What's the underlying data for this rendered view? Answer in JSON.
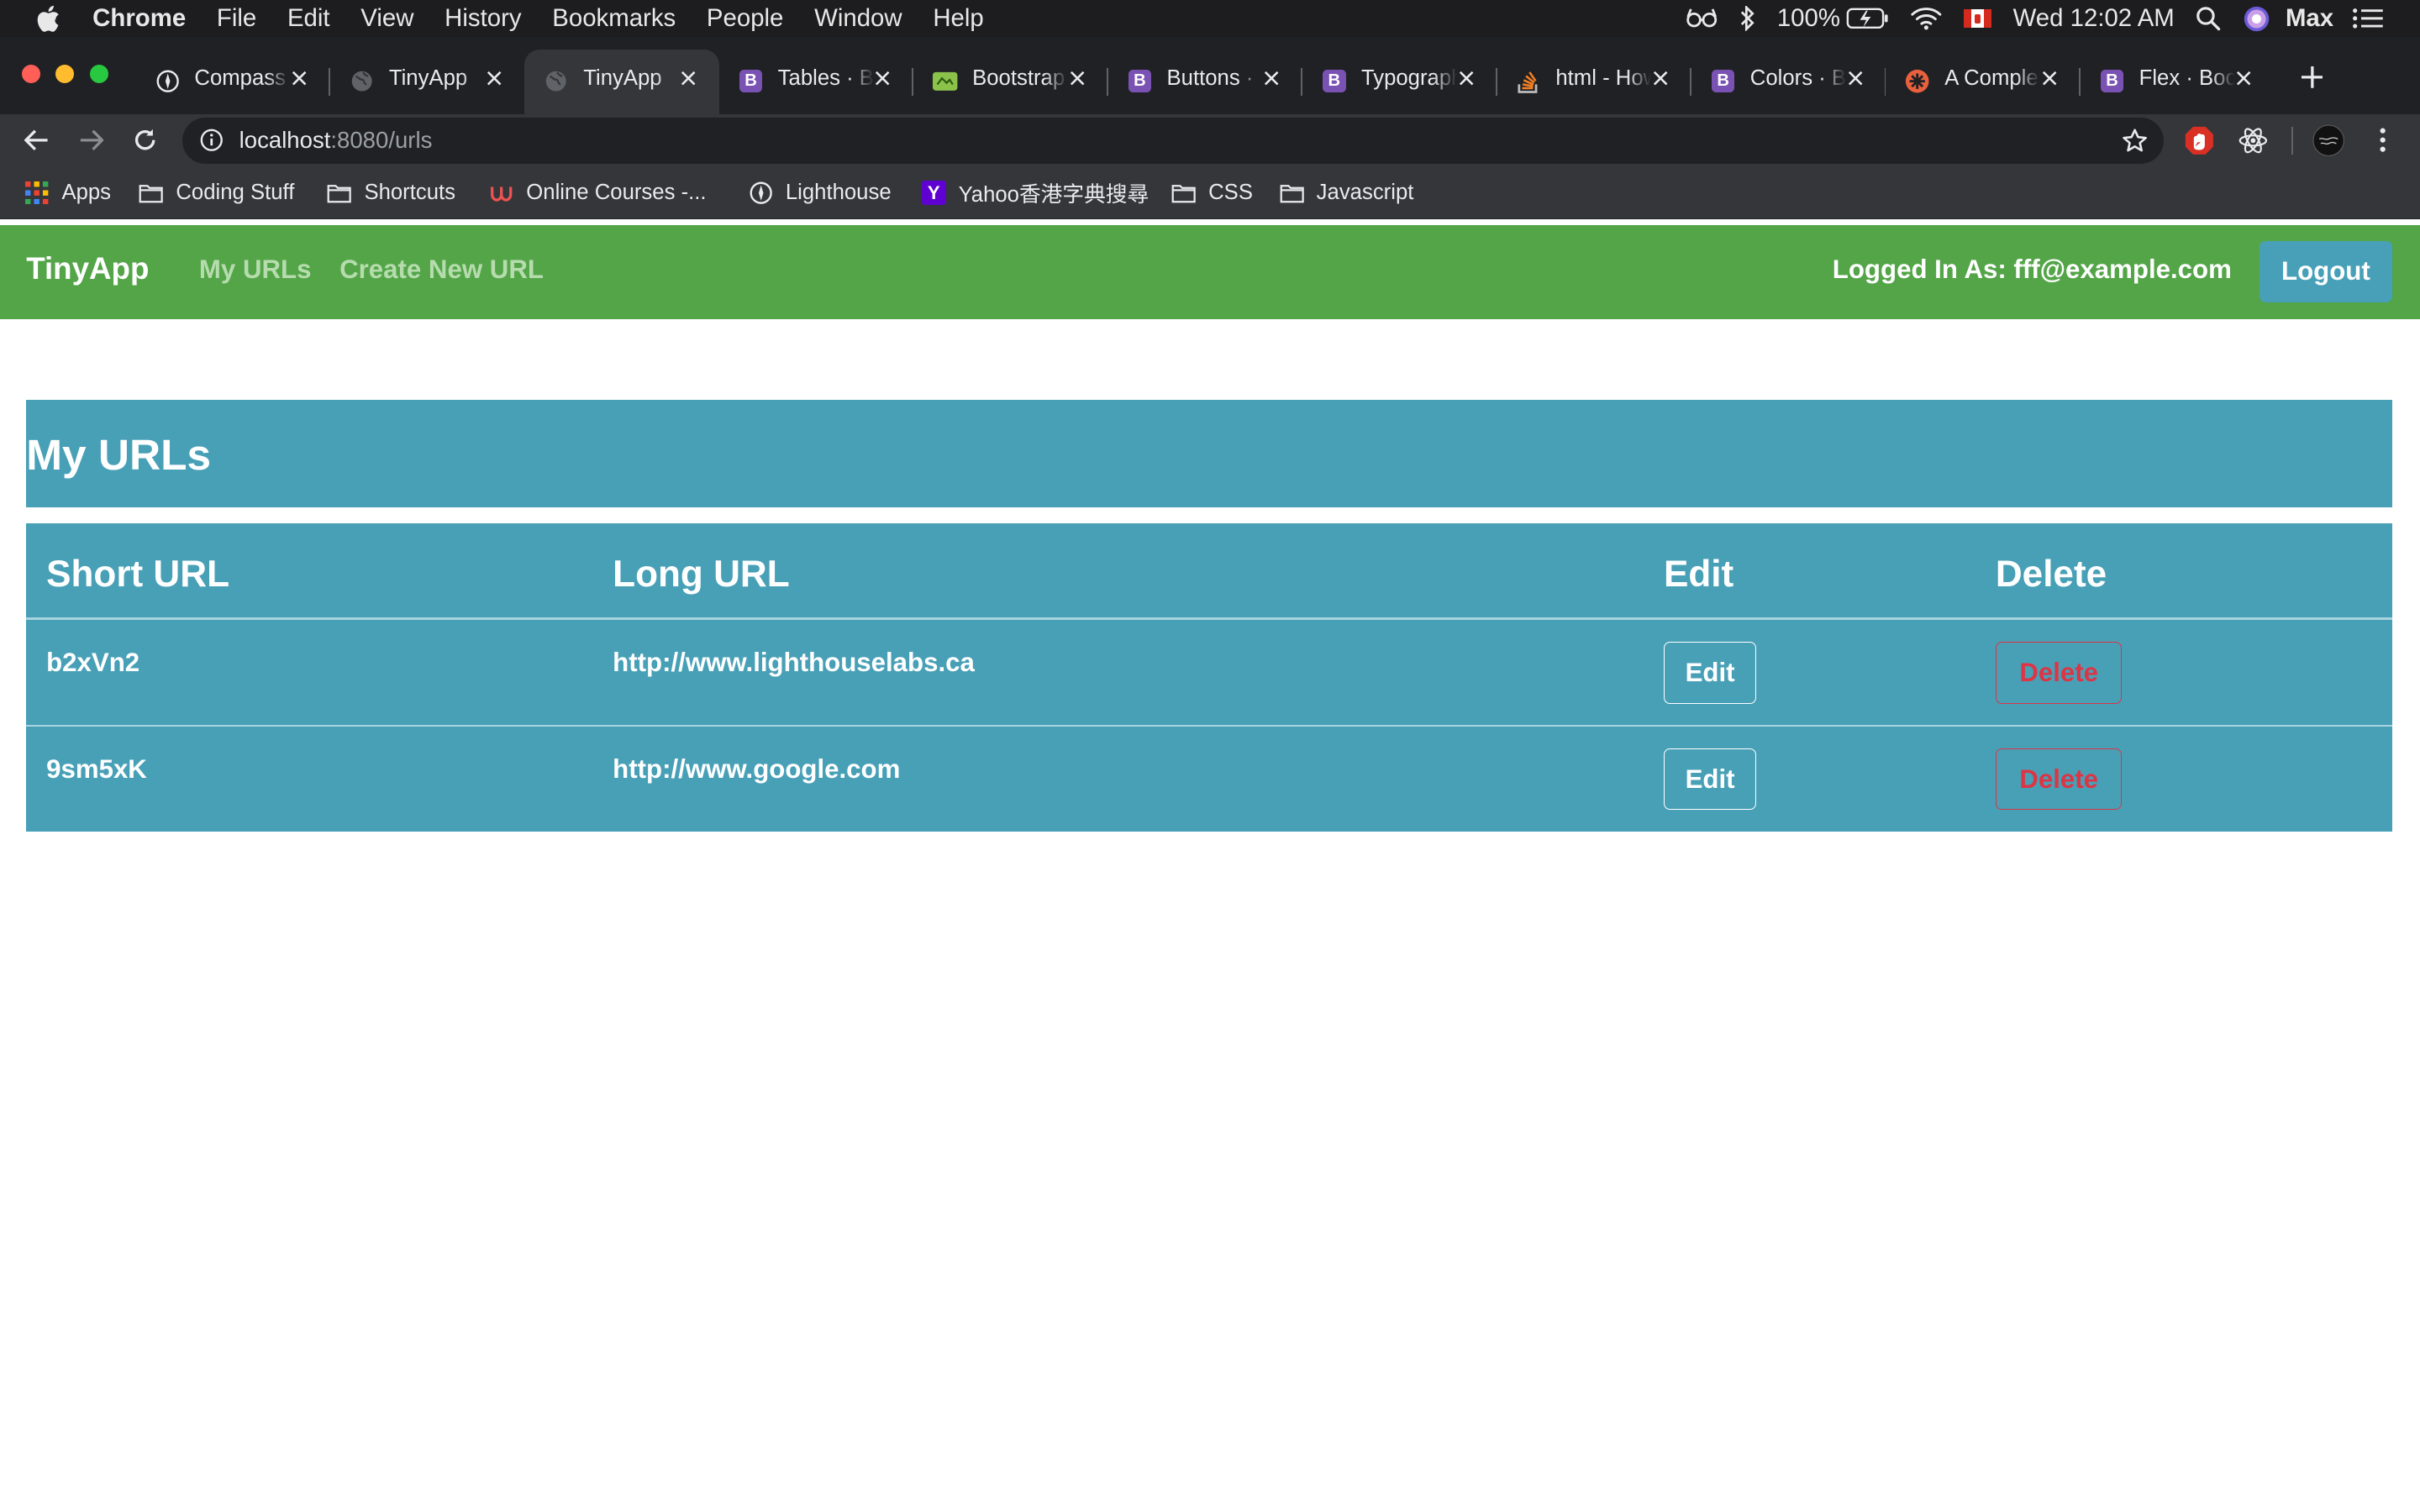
{
  "menubar": {
    "app_name": "Chrome",
    "items": [
      "File",
      "Edit",
      "View",
      "History",
      "Bookmarks",
      "People",
      "Window",
      "Help"
    ],
    "battery": "100%",
    "clock": "Wed 12:02 AM",
    "user": "Max"
  },
  "tabs": [
    {
      "title": "Compass",
      "icon": "compass-icon",
      "active": false
    },
    {
      "title": "TinyApp",
      "icon": "globe-icon",
      "active": false
    },
    {
      "title": "TinyApp",
      "icon": "globe-icon",
      "active": true
    },
    {
      "title": "Tables · B",
      "icon": "bootstrap-icon",
      "active": false
    },
    {
      "title": "Bootstrap",
      "icon": "bootstrap-themes-icon",
      "active": false
    },
    {
      "title": "Buttons ·",
      "icon": "bootstrap-icon",
      "active": false
    },
    {
      "title": "Typography",
      "icon": "bootstrap-icon",
      "active": false
    },
    {
      "title": "html - How",
      "icon": "stackoverflow-icon",
      "active": false
    },
    {
      "title": "Colors · B",
      "icon": "bootstrap-icon",
      "active": false
    },
    {
      "title": "A Complete",
      "icon": "css-tricks-icon",
      "active": false
    },
    {
      "title": "Flex · Boot",
      "icon": "bootstrap-icon",
      "active": false
    }
  ],
  "address_bar": {
    "host": "localhost",
    "path": ":8080/urls"
  },
  "bookmarks": [
    {
      "label": "Apps",
      "icon": "apps-grid-icon"
    },
    {
      "label": "Coding Stuff",
      "icon": "folder-icon"
    },
    {
      "label": "Shortcuts",
      "icon": "folder-icon"
    },
    {
      "label": "Online Courses -...",
      "icon": "udemy-icon"
    },
    {
      "label": "Lighthouse",
      "icon": "compass-icon"
    },
    {
      "label": "Yahoo香港字典搜尋",
      "icon": "yahoo-icon"
    },
    {
      "label": "CSS",
      "icon": "folder-icon"
    },
    {
      "label": "Javascript",
      "icon": "folder-icon"
    }
  ],
  "app": {
    "brand": "TinyApp",
    "nav": [
      "My URLs",
      "Create New URL"
    ],
    "logged_in_as": "Logged In As: fff@example.com",
    "logout_label": "Logout",
    "page_title": "My URLs",
    "table": {
      "headers": [
        "Short URL",
        "Long URL",
        "Edit",
        "Delete"
      ],
      "rows": [
        {
          "short": "b2xVn2",
          "long": "http://www.lighthouselabs.ca",
          "edit": "Edit",
          "delete": "Delete"
        },
        {
          "short": "9sm5xK",
          "long": "http://www.google.com",
          "edit": "Edit",
          "delete": "Delete"
        }
      ]
    }
  },
  "colors": {
    "navbar_green": "#53a548",
    "table_blue": "#48a0b7",
    "logout_blue": "#47a0b8",
    "danger_red": "#dc3545"
  }
}
